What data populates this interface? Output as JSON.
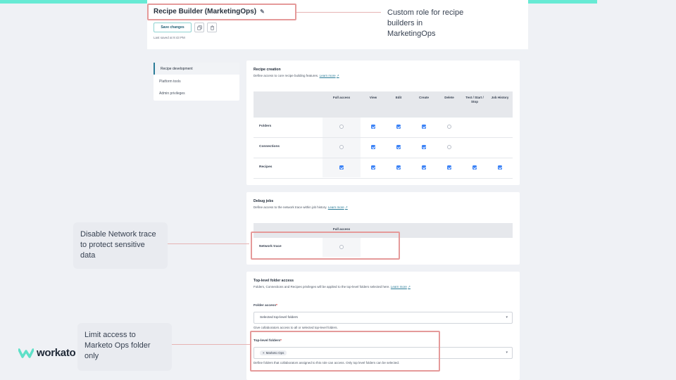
{
  "header": {
    "role_title": "Recipe Builder (MarketingOps)",
    "save_label": "Save changes",
    "last_saved": "Last saved at 9:43 PM",
    "pencil_icon": "pencil-icon",
    "copy_icon": "copy-icon",
    "delete_icon": "trash-icon"
  },
  "annotations": {
    "role_note": "Custom role for recipe builders in MarketingOps",
    "network_note": "Disable Network trace to protect sensitive data",
    "folder_note": "Limit access to Marketo Ops folder only"
  },
  "sidebar": {
    "items": [
      {
        "label": "Recipe development",
        "active": true
      },
      {
        "label": "Platform tools",
        "active": false
      },
      {
        "label": "Admin privileges",
        "active": false
      }
    ]
  },
  "recipe_creation": {
    "title": "Recipe creation",
    "desc": "Define access to core recipe building features.",
    "learn_more": "Learn more",
    "columns": [
      "Full access",
      "View",
      "Edit",
      "Create",
      "Delete",
      "Test / Start / Stop",
      "Job History"
    ],
    "rows": [
      {
        "label": "Folders",
        "checks": [
          false,
          true,
          true,
          true,
          false,
          null,
          null
        ]
      },
      {
        "label": "Connections",
        "checks": [
          false,
          true,
          true,
          true,
          false,
          null,
          null
        ]
      },
      {
        "label": "Recipes",
        "checks": [
          true,
          true,
          true,
          true,
          true,
          true,
          true
        ]
      }
    ]
  },
  "debug_jobs": {
    "title": "Debug jobs",
    "desc": "Define access to the network trace within job history.",
    "learn_more": "Learn more",
    "column": "Full access",
    "row_label": "Network trace",
    "checked": false
  },
  "folder_access": {
    "title": "Top-level folder access",
    "desc": "Folders, Connections and Recipes privileges will be applied to the top-level folders selected here.",
    "learn_more": "Learn more",
    "access_label": "Folder access",
    "access_value": "Selected top-level folders",
    "access_hint": "Give collaborators access to all or selected top-level folders.",
    "folders_label": "Top-level folders",
    "chip": "Marketo Ops",
    "folders_hint": "Define folders that collaborators assigned to this role can access. Only top level folders can be selected."
  },
  "brand": {
    "name": "workato",
    "accent": "#67ead4",
    "highlight": "#e59a9a",
    "checkbox": "#3b82f6"
  }
}
